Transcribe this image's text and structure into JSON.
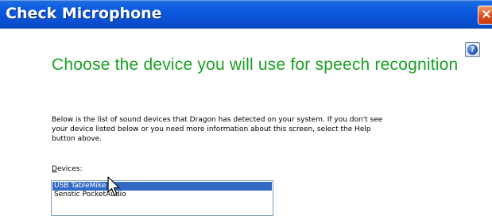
{
  "window": {
    "title": "Check Microphone",
    "close_symbol": "×"
  },
  "help": {
    "icon": "help-icon",
    "symbol": "?"
  },
  "heading": "Choose the device you will use for speech recognition",
  "description": "Below is the list of sound devices that Dragon has detected on your system. If you don't see your device listed below or you need more information about this screen, select the Help button above.",
  "devices": {
    "label_access": "D",
    "label_rest": "evices:",
    "items": [
      {
        "label": "USB TableMike",
        "selected": true
      },
      {
        "label": "Senstic PocketAudio",
        "selected": false
      }
    ]
  },
  "colors": {
    "title_bar": "#0b5ae0",
    "heading": "#1aa024",
    "selection": "#316ac5"
  }
}
